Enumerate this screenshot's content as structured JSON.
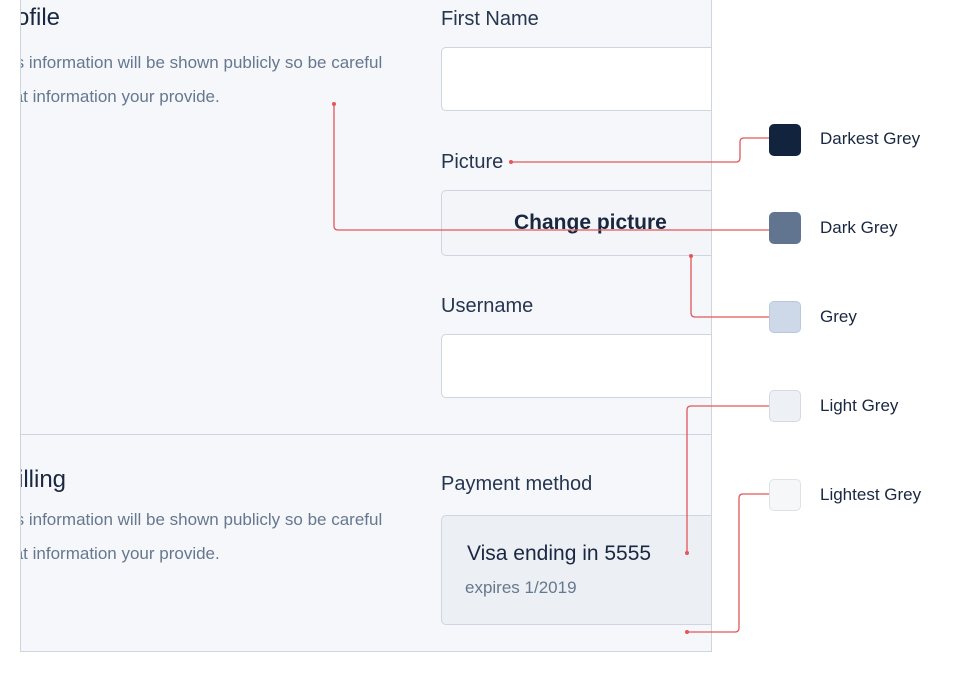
{
  "profile": {
    "title": "Profile",
    "description": "This information will be shown publicly so be careful what information your provide.",
    "first_name_label": "First Name",
    "picture_label": "Picture",
    "change_picture_label": "Change picture",
    "username_label": "Username"
  },
  "billing": {
    "title": "Billing",
    "description": "This information will be shown publicly so be careful what information your provide.",
    "payment_method_label": "Payment method",
    "card_title": "Visa ending in 5555",
    "card_expiry": "expires 1/2019"
  },
  "palette": [
    {
      "name": "Darkest Grey",
      "color": "#12233e"
    },
    {
      "name": "Dark Grey",
      "color": "#627590"
    },
    {
      "name": "Grey",
      "color": "#cdd8e8"
    },
    {
      "name": "Light Grey",
      "color": "#edf0f4"
    },
    {
      "name": "Lightest Grey",
      "color": "#f6f7f9"
    }
  ],
  "annotation_color": "#e2575a"
}
